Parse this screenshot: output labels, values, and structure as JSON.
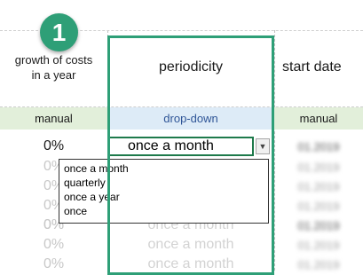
{
  "headers": {
    "growth": "growth of costs\nin a year",
    "periodicity": "periodicity",
    "start_date": "start date"
  },
  "input_types": {
    "growth": "manual",
    "periodicity": "drop-down",
    "start_date": "manual"
  },
  "rows": [
    {
      "growth": "0%",
      "periodicity": "once a month",
      "start_date": "01.2019"
    },
    {
      "growth": "0%",
      "periodicity": "",
      "start_date": "01.2019"
    },
    {
      "growth": "0%",
      "periodicity": "",
      "start_date": "01.2019"
    },
    {
      "growth": "0%",
      "periodicity": "",
      "start_date": "01.2019"
    },
    {
      "growth": "0%",
      "periodicity": "",
      "start_date": "01.2019"
    },
    {
      "growth": "0%",
      "periodicity": "once a month",
      "start_date": "01.2019"
    },
    {
      "growth": "0%",
      "periodicity": "once a month",
      "start_date": "01.2019"
    },
    {
      "growth": "0%",
      "periodicity": "once a month",
      "start_date": "01.2019"
    }
  ],
  "dropdown": {
    "options": [
      "once a month",
      "quarterly",
      "once a year",
      "once"
    ]
  },
  "badge": {
    "number": "1",
    "color": "#2e9f77"
  }
}
